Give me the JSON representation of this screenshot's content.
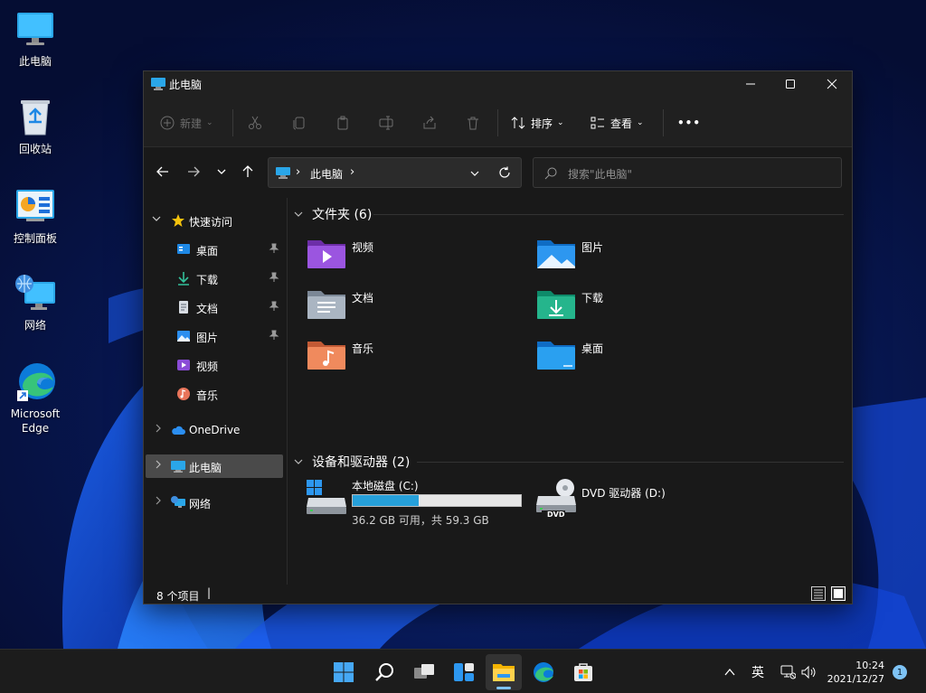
{
  "desktop": {
    "icons": [
      {
        "label": "此电脑"
      },
      {
        "label": "回收站"
      },
      {
        "label": "控制面板"
      },
      {
        "label": "网络"
      },
      {
        "label": "Microsoft\nEdge"
      }
    ]
  },
  "window": {
    "title": "此电脑",
    "controls": {
      "minimize": "—",
      "maximize": "☐",
      "close": "✕"
    }
  },
  "toolbar": {
    "new_label": "新建",
    "sort_label": "排序",
    "view_label": "查看",
    "more_label": "•••"
  },
  "addressbar": {
    "crumb": "此电脑"
  },
  "search": {
    "placeholder": "搜索\"此电脑\""
  },
  "navpane": {
    "quick_access": "快速访问",
    "quick_items": [
      {
        "label": "桌面",
        "icon": "desktop-icon",
        "pinned": true
      },
      {
        "label": "下载",
        "icon": "download-icon",
        "pinned": true
      },
      {
        "label": "文档",
        "icon": "document-icon",
        "pinned": true
      },
      {
        "label": "图片",
        "icon": "picture-icon",
        "pinned": true
      },
      {
        "label": "视频",
        "icon": "video-icon",
        "pinned": false
      },
      {
        "label": "音乐",
        "icon": "music-icon",
        "pinned": false
      }
    ],
    "onedrive": "OneDrive",
    "this_pc": "此电脑",
    "network": "网络"
  },
  "content": {
    "folders_header": "文件夹 (6)",
    "folders": [
      {
        "label": "视频",
        "icon": "video-folder-icon"
      },
      {
        "label": "图片",
        "icon": "pictures-folder-icon"
      },
      {
        "label": "文档",
        "icon": "documents-folder-icon"
      },
      {
        "label": "下载",
        "icon": "downloads-folder-icon"
      },
      {
        "label": "音乐",
        "icon": "music-folder-icon"
      },
      {
        "label": "桌面",
        "icon": "desktop-folder-icon"
      }
    ],
    "drives_header": "设备和驱动器 (2)",
    "drive_c": {
      "label": "本地磁盘 (C:)",
      "free_text": "36.2 GB 可用，共 59.3 GB",
      "used_fraction": 0.39
    },
    "drive_d": {
      "label": "DVD 驱动器 (D:)",
      "badge": "DVD"
    }
  },
  "status": {
    "items_count": "8 个项目"
  },
  "taskbar": {
    "ime": "英",
    "time": "10:24",
    "date": "2021/12/27",
    "notification_count": "1",
    "accent": "#7ec3f5"
  }
}
